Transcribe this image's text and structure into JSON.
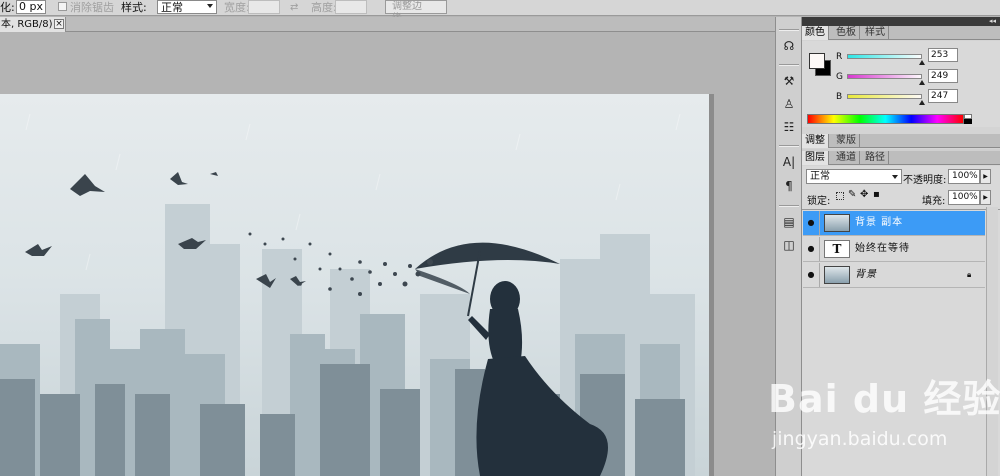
{
  "options_bar": {
    "feather_label": "化:",
    "feather_value": "0 px",
    "antialias_label": "消除锯齿",
    "style_label": "样式:",
    "style_value": "正常",
    "width_label": "宽度:",
    "height_label": "高度:",
    "refine_edge_label": "调整边缘..."
  },
  "document": {
    "tab_title": "本, RGB/8) *",
    "close_symbol": "×"
  },
  "panels": {
    "collapse_symbol": "◂◂",
    "color_tabs": [
      "颜色",
      "色板",
      "样式"
    ],
    "color": {
      "r_label": "R",
      "g_label": "G",
      "b_label": "B",
      "r": 253,
      "g": 249,
      "b": 247,
      "r_color": "#2ee6e6",
      "g_color": "#e03ad8",
      "b_color": "#e8e83a"
    },
    "adjust_tabs": [
      "调整",
      "蒙版"
    ],
    "layers_tabs": [
      "图层",
      "通道",
      "路径"
    ],
    "layers": {
      "blend_mode": "正常",
      "opacity_label": "不透明度:",
      "opacity": "100%",
      "lock_label": "锁定:",
      "fill_label": "填充:",
      "fill": "100%",
      "items": [
        {
          "name": "背景 副本",
          "type": "image",
          "selected": true
        },
        {
          "name": "始终在等待",
          "type": "text",
          "thumb_label": "T",
          "selected": false
        },
        {
          "name": "背景",
          "type": "image",
          "selected": false,
          "locked": true
        }
      ]
    }
  },
  "tools": [
    {
      "icon": "history-brush-icon",
      "glyph": "☊"
    },
    {
      "icon": "tool-presets-icon",
      "glyph": "⚒"
    },
    {
      "icon": "clone-source-icon",
      "glyph": "♙"
    },
    {
      "icon": "layer-comps-icon",
      "glyph": "☷"
    },
    {
      "icon": "character-icon",
      "glyph": "A|"
    },
    {
      "icon": "paragraph-icon",
      "glyph": "¶"
    },
    {
      "icon": "notes-icon",
      "glyph": "▤"
    },
    {
      "icon": "navigator-icon",
      "glyph": "◫"
    }
  ],
  "watermark": {
    "logo_text": "Bai du 经验",
    "url": "jingyan.baidu.com"
  }
}
